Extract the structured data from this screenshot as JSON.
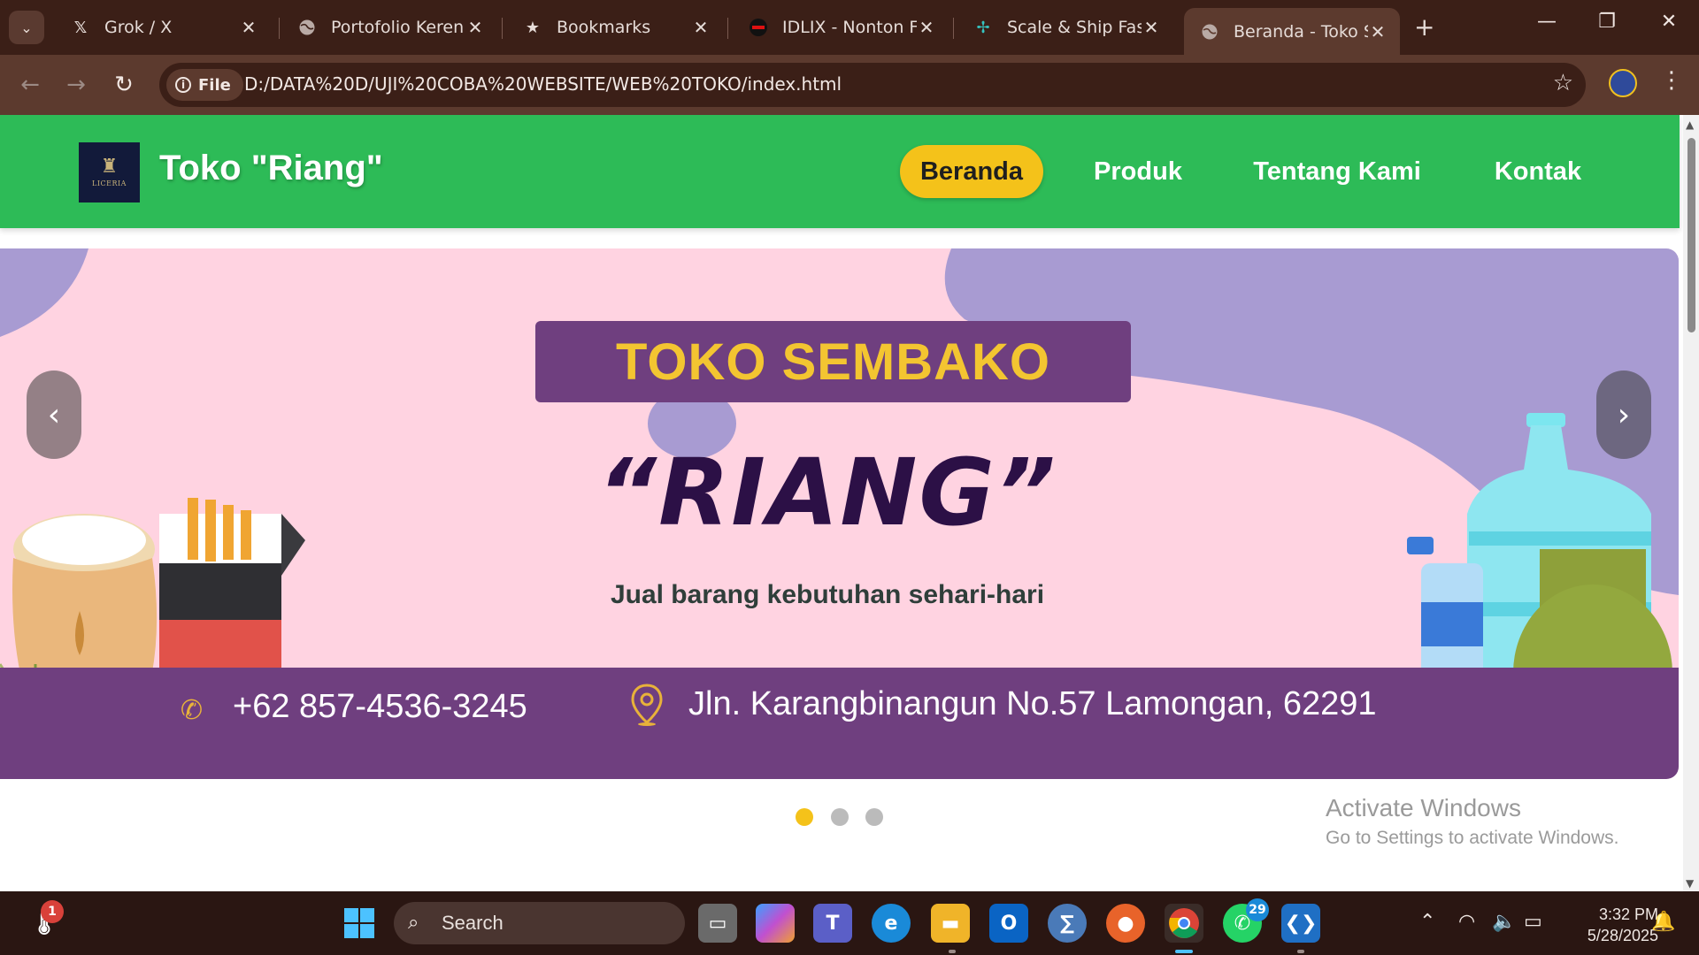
{
  "browser": {
    "tabs": [
      {
        "title": "Grok / X",
        "icon": "x-logo-icon"
      },
      {
        "title": "Portofolio Keren",
        "icon": "globe-icon"
      },
      {
        "title": "Bookmarks",
        "icon": "star-icon"
      },
      {
        "title": "IDLIX - Nonton Film",
        "icon": "idlix-icon"
      },
      {
        "title": "Scale & Ship Faster",
        "icon": "sparkle-icon"
      },
      {
        "title": "Beranda - Toko Sembako",
        "icon": "globe-icon",
        "active": true
      }
    ],
    "file_chip": "File",
    "url": "D:/DATA%20D/UJI%20COBA%20WEBSITE/WEB%20TOKO/index.html"
  },
  "site": {
    "brand": "Toko \"Riang\"",
    "logo_text": "LICERIA",
    "nav": [
      {
        "label": "Beranda",
        "active": true
      },
      {
        "label": "Produk"
      },
      {
        "label": "Tentang Kami"
      },
      {
        "label": "Kontak"
      }
    ],
    "banner": {
      "title": "TOKO SEMBAKO",
      "name": "“RIANG”",
      "tagline": "Jual barang kebutuhan sehari-hari",
      "phone": "+62 857-4536-3245",
      "address": "Jln. Karangbinangun No.57 Lamongan, 62291",
      "cigarette_label": "CIGARETTES",
      "prev": "‹",
      "next": "›"
    },
    "carousel": {
      "slides": 3,
      "active_index": 0
    }
  },
  "watermark": {
    "line1": "Activate Windows",
    "line2": "Go to Settings to activate Windows."
  },
  "taskbar": {
    "search_placeholder": "Search",
    "notif_badge": "1",
    "whatsapp_badge": "29",
    "time": "3:32 PM",
    "date": "5/28/2025"
  },
  "colors": {
    "header_green": "#2dbb57",
    "accent_yellow": "#f4c21a",
    "banner_pink": "#ffd3e1",
    "banner_purple": "#6f3f7f",
    "browser_brown": "#5c3a2e"
  }
}
